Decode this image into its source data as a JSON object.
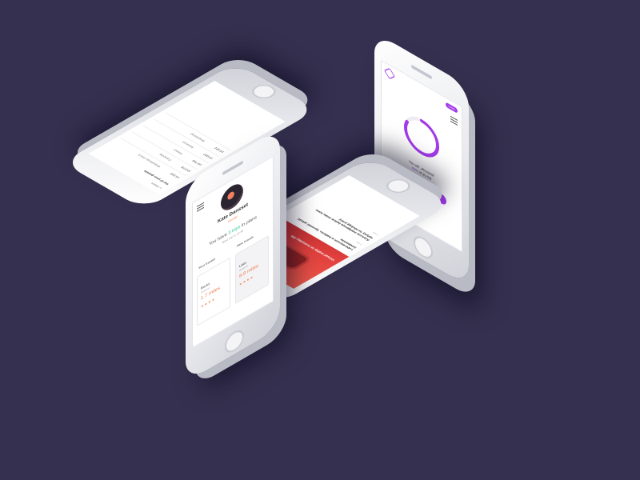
{
  "profile": {
    "name": "Kate Dansset",
    "subtitle": "traveler",
    "have_prefix": "You have ",
    "have_count": "3 trips",
    "have_suffix": " in plans",
    "small": "Next trip in 12:30",
    "your_travels": "Your travels",
    "new_travels": "New travels",
    "card1": {
      "name": "Rocks",
      "date": "distance",
      "miles": "1.7 miles",
      "stars": "★★★★"
    },
    "card2": {
      "name": "Lake",
      "date": "distance",
      "miles": "8.6 miles",
      "stars": "★★★★"
    }
  },
  "timer": {
    "badge": "Lorem",
    "line1": "You will „Akceptuj”",
    "line2_prefix": "",
    "line2_highlight": "42%",
    "line2_suffix": " of 25 GB",
    "button": "Next Step",
    "progress": 0.82
  },
  "travel_list": {
    "header_left": "« return",
    "header_right": "« return",
    "heading": "list of your guests",
    "rows": [
      {
        "time": "14:322",
        "text": "Brandshop check"
      },
      {
        "time": "15:978",
        "text": "Camping"
      },
      {
        "time": "19:760",
        "text": "Dinner"
      },
      {
        "time": "14:022",
        "text": "Museum"
      },
      {
        "time": "14:322",
        "text": "Brandshop"
      }
    ]
  },
  "news": {
    "hero_title": "Virtual reality in everyday life",
    "item1": "Laboratorium w badaniu. Sprawdź jakość środowiska",
    "item2": "Sztuczna inteligencja będzie miała nowe wpływy na obsługę pracy",
    "meta1": "5 min",
    "meta2": "7 min"
  }
}
